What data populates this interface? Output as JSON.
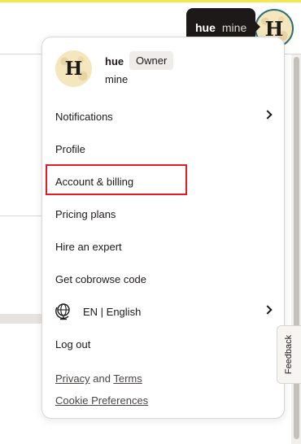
{
  "user": {
    "initial": "H",
    "name": "hue",
    "team": "mine",
    "role": "Owner"
  },
  "tooltip": {
    "name": "hue",
    "team": "mine"
  },
  "menu": {
    "items": [
      {
        "label": "Notifications"
      },
      {
        "label": "Profile"
      },
      {
        "label": "Account & billing"
      },
      {
        "label": "Pricing plans"
      },
      {
        "label": "Hire an expert"
      },
      {
        "label": "Get cobrowse code"
      },
      {
        "label": "EN | English"
      },
      {
        "label": "Log out"
      }
    ],
    "footer": {
      "privacy": "Privacy",
      "and": "and",
      "terms": "Terms",
      "cookie": "Cookie Preferences"
    }
  },
  "feedback": {
    "label": "Feedback"
  },
  "colors": {
    "accent_bar": "#f2e94e",
    "highlight": "#e21b26",
    "tooltip_bg": "#1e1919",
    "avatar_ring": "#2f6f78"
  },
  "icons": [
    "chevron-right-icon",
    "globe-icon"
  ]
}
